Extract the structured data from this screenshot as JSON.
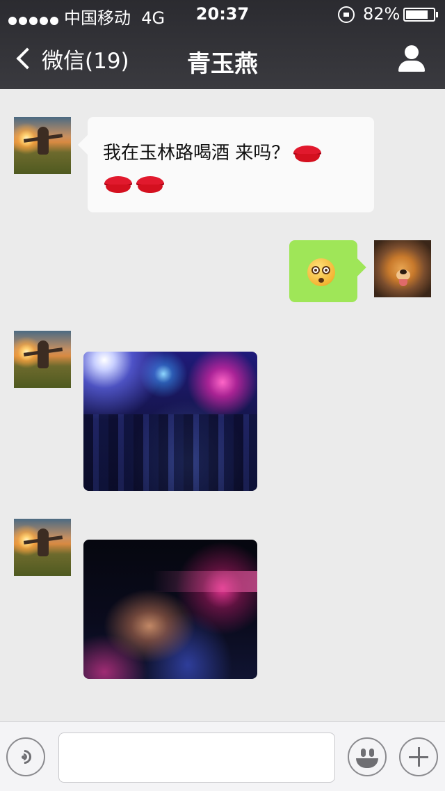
{
  "status_bar": {
    "carrier": "中国移动",
    "network": "4G",
    "time": "20:37",
    "battery_percent": "82%",
    "battery_level": 0.82,
    "signal_dots": 5
  },
  "nav": {
    "back_label": "微信(19)",
    "title": "青玉燕"
  },
  "messages": [
    {
      "sender": "contact",
      "type": "text",
      "text": "我在玉林路喝酒 来吗？",
      "emojis": [
        "lips-icon",
        "lips-icon",
        "lips-icon"
      ]
    },
    {
      "sender": "self",
      "type": "emoji",
      "emoji": "dizzy-face-icon"
    },
    {
      "sender": "contact",
      "type": "image",
      "image": "nightclub-crowd-photo"
    },
    {
      "sender": "contact",
      "type": "image",
      "image": "nightclub-dancer-photo"
    }
  ],
  "input_bar": {
    "value": "",
    "placeholder": "",
    "icons": [
      "voice-icon",
      "smiley-icon",
      "plus-icon"
    ]
  },
  "colors": {
    "background": "#ebebeb",
    "topbar": "#333338",
    "incoming_bubble": "#fafafa",
    "outgoing_bubble": "#9fe658"
  }
}
